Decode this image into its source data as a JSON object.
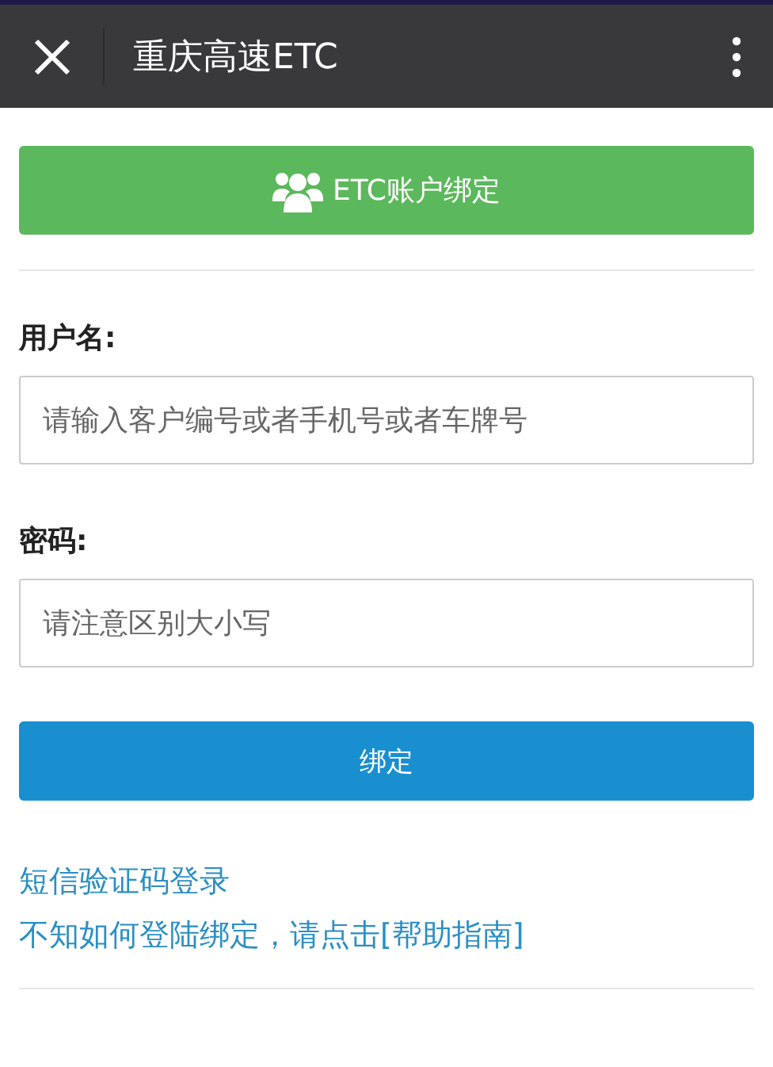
{
  "header": {
    "title": "重庆高速ETC"
  },
  "bind_banner": {
    "label": "ETC账户绑定"
  },
  "fields": [
    {
      "label": "用户名:",
      "placeholder": "请输入客户编号或者手机号或者车牌号"
    },
    {
      "label": "密码:",
      "placeholder": "请注意区别大小写"
    }
  ],
  "submit": {
    "label": "绑定"
  },
  "links": [
    "短信验证码登录",
    "不知如何登陆绑定，请点击[帮助指南]"
  ]
}
